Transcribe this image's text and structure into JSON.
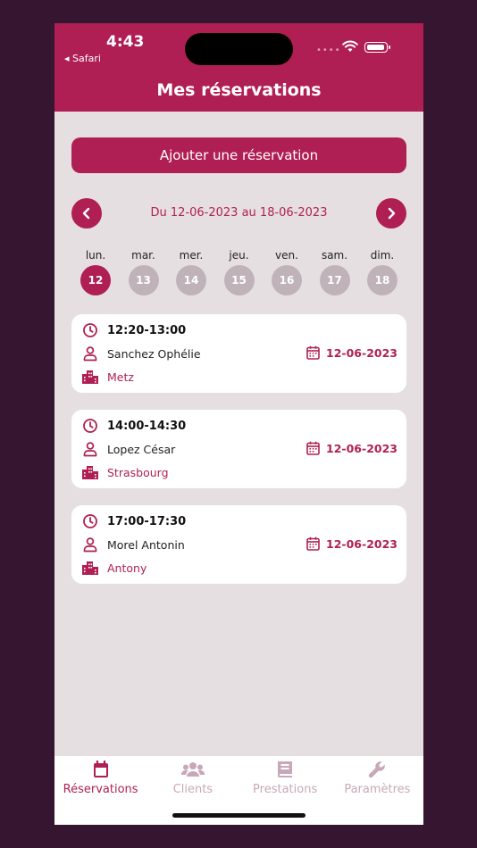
{
  "status": {
    "time": "4:43",
    "back_label": "◂ Safari",
    "signal_dots": "••••"
  },
  "header": {
    "title": "Mes réservations"
  },
  "add_button": {
    "label": "Ajouter une réservation"
  },
  "week": {
    "range": "Du 12-06-2023 au 18-06-2023",
    "days": [
      {
        "name": "lun.",
        "num": "12"
      },
      {
        "name": "mar.",
        "num": "13"
      },
      {
        "name": "mer.",
        "num": "14"
      },
      {
        "name": "jeu.",
        "num": "15"
      },
      {
        "name": "ven.",
        "num": "16"
      },
      {
        "name": "sam.",
        "num": "17"
      },
      {
        "name": "dim.",
        "num": "18"
      }
    ]
  },
  "reservations": [
    {
      "time": "12:20-13:00",
      "client": "Sanchez Ophélie",
      "city": "Metz",
      "date": "12-06-2023"
    },
    {
      "time": "14:00-14:30",
      "client": "Lopez César",
      "city": "Strasbourg",
      "date": "12-06-2023"
    },
    {
      "time": "17:00-17:30",
      "client": "Morel Antonin",
      "city": "Antony",
      "date": "12-06-2023"
    }
  ],
  "tabs": [
    {
      "label": "Réservations",
      "icon": "calendar-icon"
    },
    {
      "label": "Clients",
      "icon": "users-icon"
    },
    {
      "label": "Prestations",
      "icon": "book-icon"
    },
    {
      "label": "Paramètres",
      "icon": "wrench-icon"
    }
  ],
  "colors": {
    "brand": "#b01f53",
    "background": "#35152f",
    "surface": "#e6dfe2",
    "inactive_day": "#bfb3b9",
    "inactive_tab": "#c8a8b8"
  }
}
